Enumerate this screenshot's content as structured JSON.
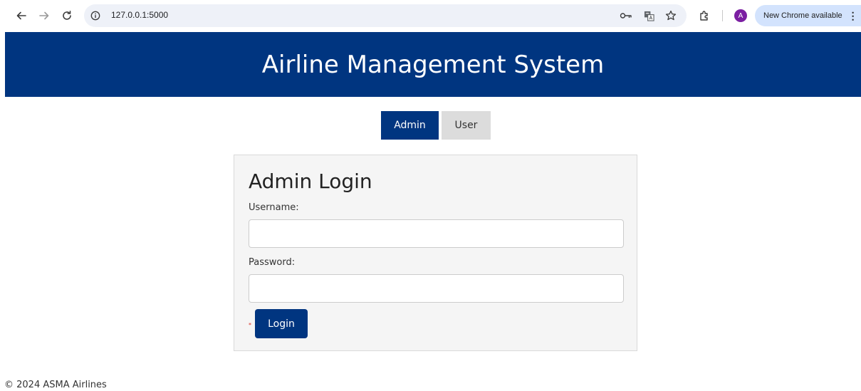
{
  "browser": {
    "url": "127.0.0.1:5000",
    "profile_initial": "A",
    "update_label": "New Chrome available",
    "kebab": "⋮",
    "icons": [
      "back-arrow-icon",
      "forward-arrow-icon",
      "reload-icon",
      "site-info-icon",
      "password-key-icon",
      "translate-icon",
      "bookmark-star-icon",
      "extensions-puzzle-icon"
    ]
  },
  "header": {
    "title": "Airline Management System",
    "background_color": "#003580"
  },
  "tabs": [
    {
      "label": "Admin",
      "active": true
    },
    {
      "label": "User",
      "active": false
    }
  ],
  "login": {
    "heading": "Admin Login",
    "username_label": "Username:",
    "username_value": "",
    "password_label": "Password:",
    "password_value": "",
    "required_mark": "*",
    "submit_label": "Login"
  },
  "footer": {
    "text": "© 2024 ASMA Airlines"
  },
  "colors": {
    "primary": "#003580",
    "tab_inactive": "#dcdcdc",
    "card_bg": "#f5f5f5"
  }
}
